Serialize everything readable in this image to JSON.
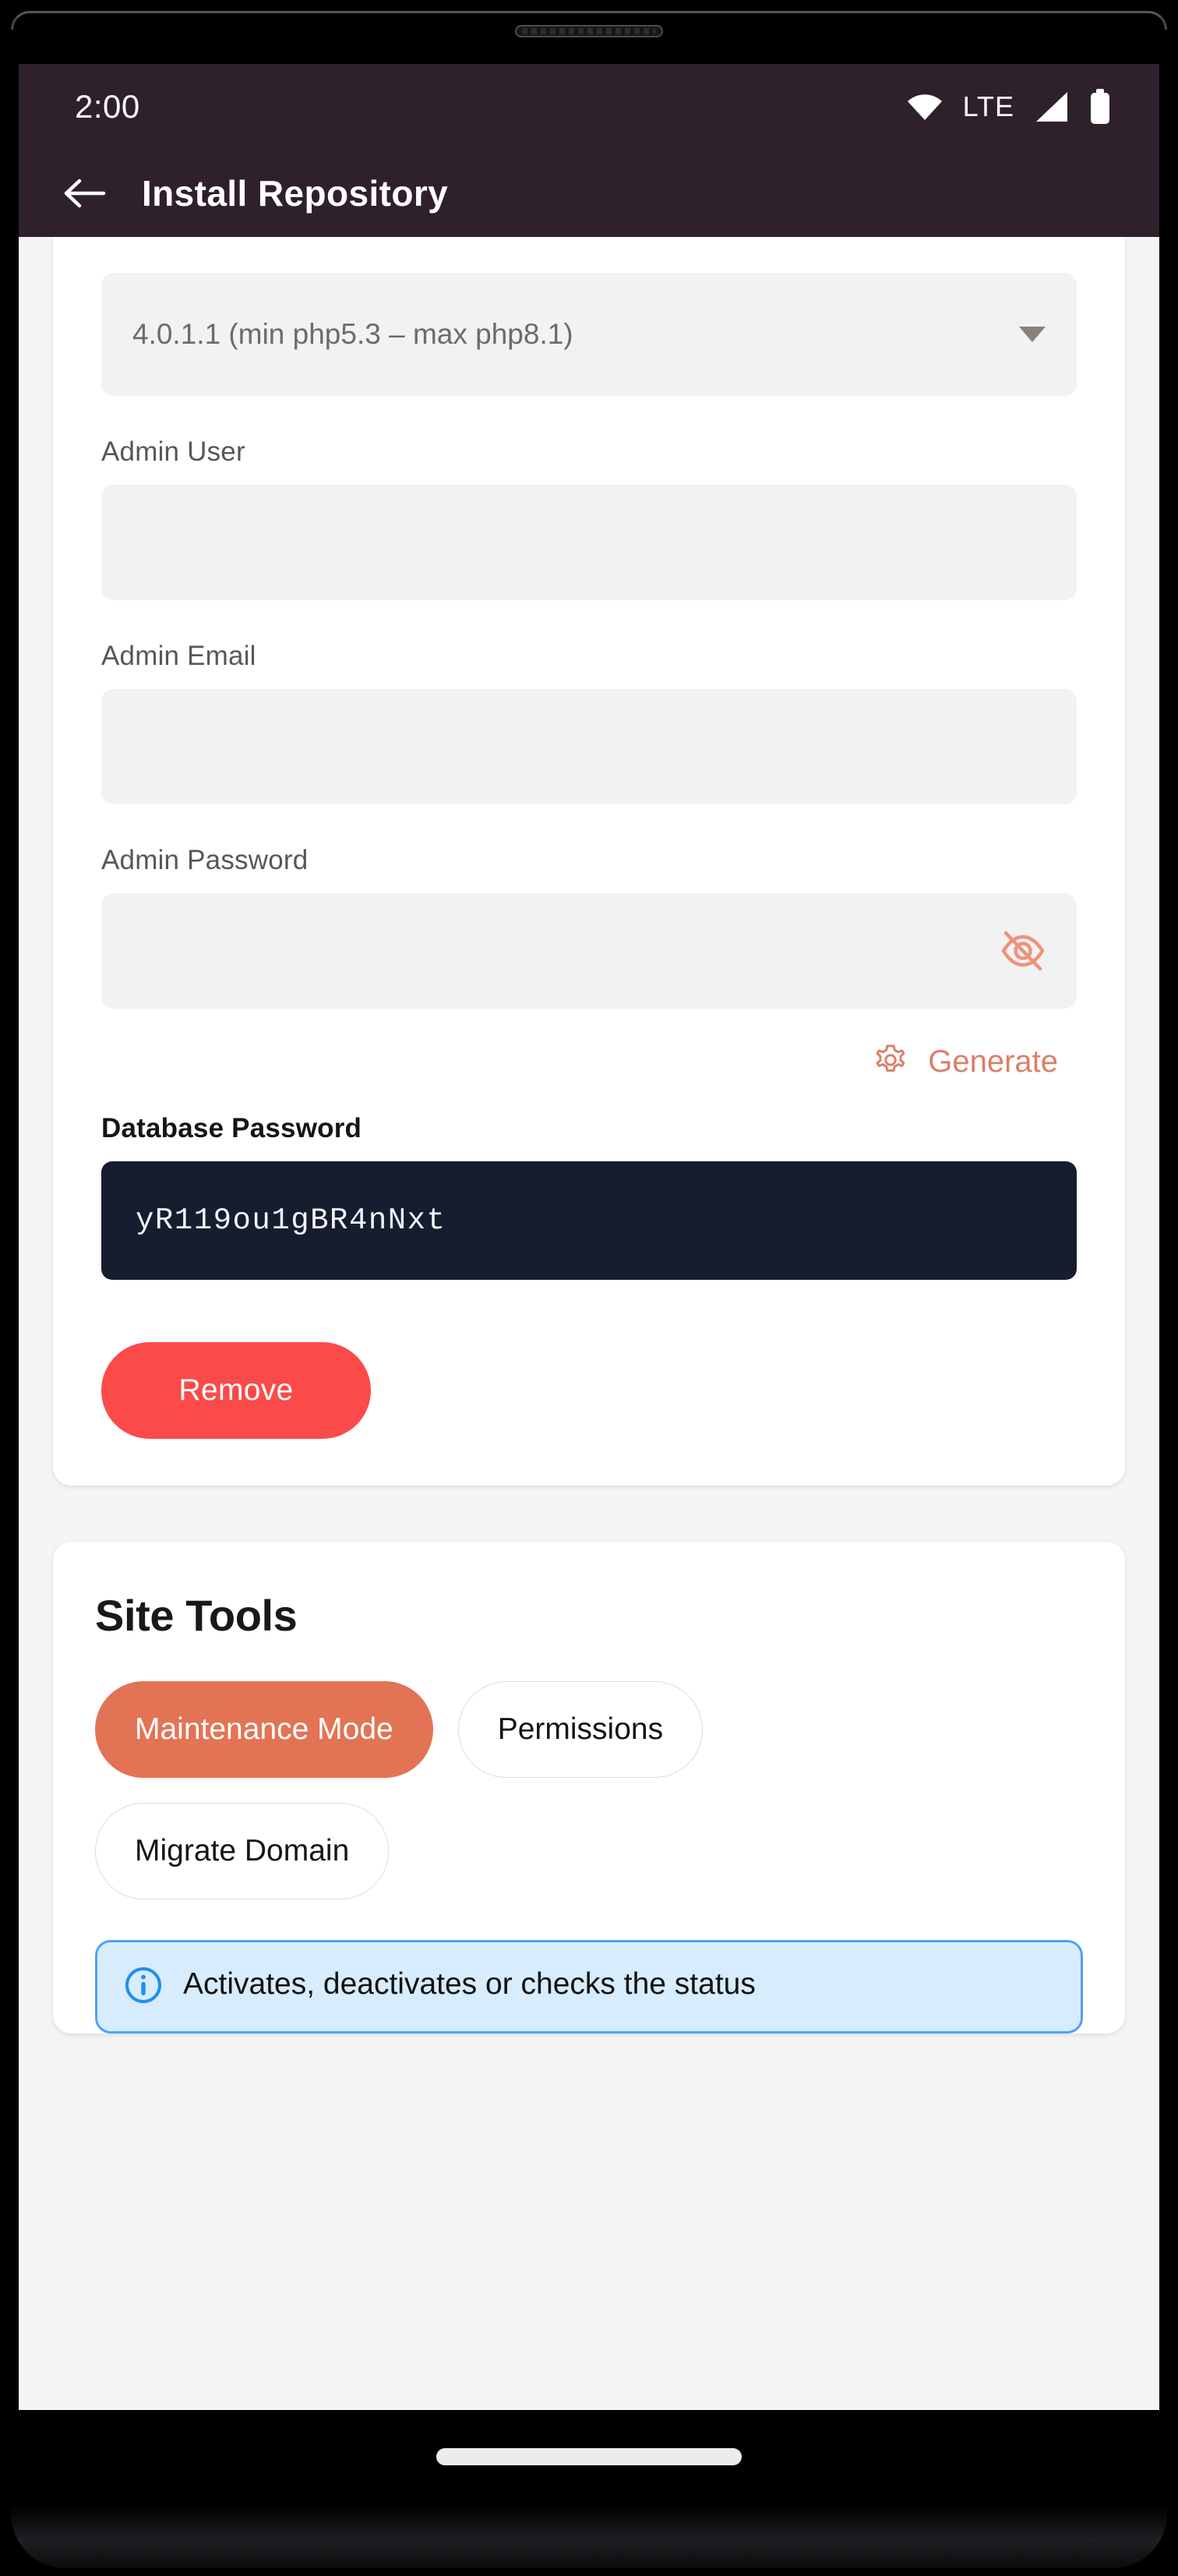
{
  "status_bar": {
    "time": "2:00",
    "network_label": "LTE",
    "icons": [
      "wifi-icon",
      "signal-icon",
      "battery-icon"
    ]
  },
  "app_bar": {
    "back_icon": "arrow-left-icon",
    "title": "Install Repository"
  },
  "install_card": {
    "version_select": {
      "value": "4.0.1.1 (min php5.3 – max php8.1)",
      "caret_icon": "chevron-down-icon"
    },
    "admin_user": {
      "label": "Admin User",
      "value": "",
      "placeholder": ""
    },
    "admin_email": {
      "label": "Admin Email",
      "value": "",
      "placeholder": ""
    },
    "admin_password": {
      "label": "Admin Password",
      "value": "",
      "placeholder": "",
      "visibility_icon": "eye-off-icon"
    },
    "generate": {
      "icon": "gear-icon",
      "label": "Generate"
    },
    "database_password": {
      "label": "Database Password",
      "value": "yR119ou1gBR4nNxt"
    },
    "remove_button": {
      "label": "Remove"
    }
  },
  "site_tools": {
    "title": "Site Tools",
    "chips": [
      {
        "label": "Maintenance Mode",
        "selected": true
      },
      {
        "label": "Permissions",
        "selected": false
      },
      {
        "label": "Migrate Domain",
        "selected": false
      }
    ],
    "info_banner": {
      "icon": "info-icon",
      "text": "Activates, deactivates or checks the status"
    }
  },
  "nav_bar": {
    "home_indicator": "home-indicator"
  },
  "colors": {
    "app_bar": "#2e212b",
    "page_background": "#f5f5f5",
    "card": "#ffffff",
    "accent_coral": "#e27455",
    "generate_coral": "#db7f6a",
    "remove_red": "#fb4a4a",
    "db_password_bg": "#161d2e",
    "info_bg": "#d7ecfd",
    "info_border": "#4ea3f5"
  }
}
